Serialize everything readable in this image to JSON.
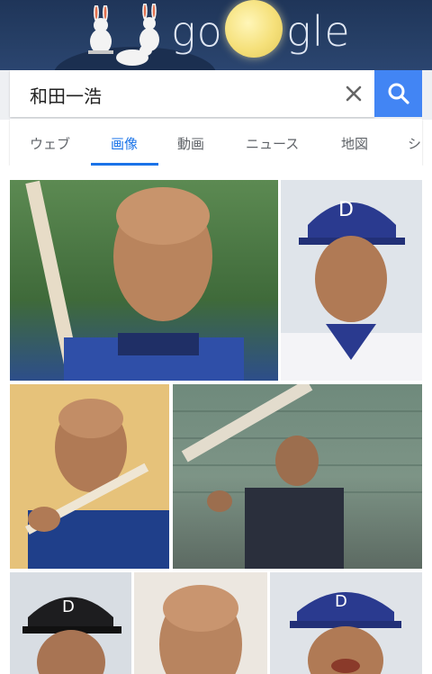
{
  "doodle": {
    "logo_text_left": "go",
    "logo_text_right": "gle"
  },
  "search": {
    "query": "和田一浩"
  },
  "tabs": [
    {
      "label": "ウェブ"
    },
    {
      "label": "画像"
    },
    {
      "label": "動画"
    },
    {
      "label": "ニュース"
    },
    {
      "label": "地図"
    },
    {
      "label": "シ"
    }
  ],
  "active_tab": "画像",
  "colors": {
    "accent": "#4285f4",
    "active_tab": "#1a73e8",
    "doodle_bg": "#263f66"
  },
  "images": [
    {
      "label": "image-result-1"
    },
    {
      "label": "image-result-2"
    },
    {
      "label": "image-result-3"
    },
    {
      "label": "image-result-4"
    },
    {
      "label": "image-result-5"
    },
    {
      "label": "image-result-6"
    },
    {
      "label": "image-result-7"
    }
  ]
}
